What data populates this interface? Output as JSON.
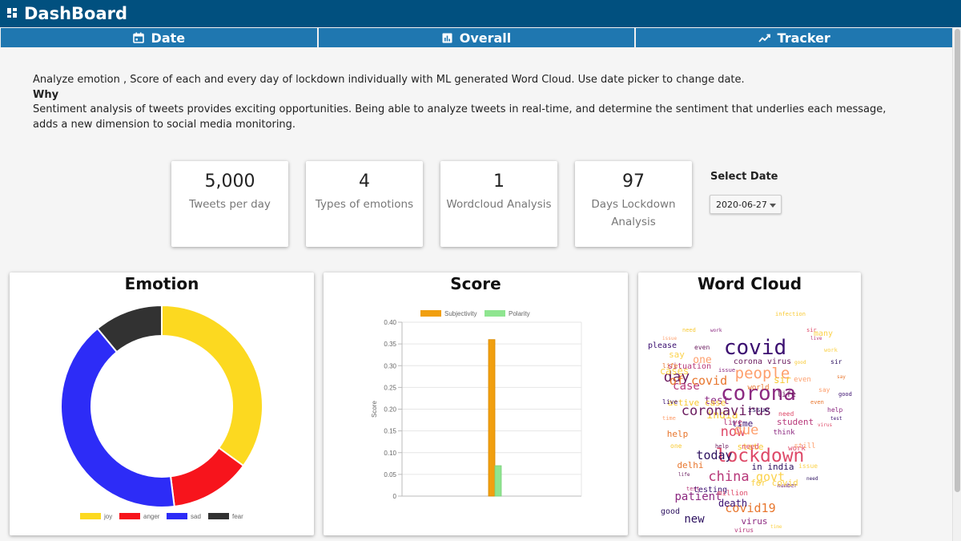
{
  "header": {
    "title": "DashBoard"
  },
  "tabs": [
    {
      "label": "Date",
      "icon": "calendar-icon"
    },
    {
      "label": "Overall",
      "icon": "bar-chart-icon"
    },
    {
      "label": "Tracker",
      "icon": "trend-line-icon"
    }
  ],
  "intro": {
    "line1": "Analyze emotion , Score of each and every day of lockdown individually with ML generated Word Cloud. Use date picker to change date.",
    "why": "Why",
    "line2": "Sentiment analysis of tweets provides exciting opportunities. Being able to analyze tweets in real-time, and determine the sentiment that underlies each message, adds a new dimension to social media monitoring."
  },
  "stats": [
    {
      "value": "5,000",
      "label": "Tweets per day"
    },
    {
      "value": "4",
      "label": "Types of emotions"
    },
    {
      "value": "1",
      "label": "Wordcloud Analysis"
    },
    {
      "value": "97",
      "label": "Days Lockdown Analysis"
    }
  ],
  "date_picker": {
    "label": "Select Date",
    "value": "2020-06-27"
  },
  "cards": {
    "emotion": {
      "title": "Emotion"
    },
    "score": {
      "title": "Score"
    },
    "wordcloud": {
      "title": "Word Cloud"
    }
  },
  "colors": {
    "header_bg": "#01507f",
    "tabs_bg": "#1f77b0",
    "joy": "#fcd920",
    "anger": "#f7141c",
    "sad": "#2d2cf7",
    "fear": "#323232",
    "subjectivity": "#f19f0f",
    "polarity": "#8fe590"
  },
  "chart_data": [
    {
      "type": "pie",
      "variant": "doughnut",
      "categories": [
        "joy",
        "anger",
        "sad",
        "fear"
      ],
      "values": [
        35,
        13,
        41,
        11
      ],
      "legend": "bottom"
    },
    {
      "type": "bar",
      "categories": [
        ""
      ],
      "series": [
        {
          "name": "Subjectivity",
          "values": [
            0.36
          ]
        },
        {
          "name": "Polarity",
          "values": [
            0.07
          ]
        }
      ],
      "ylabel": "Score",
      "ylim": [
        0,
        0.4
      ],
      "yticks": [
        "0",
        "0.05",
        "0.10",
        "0.15",
        "0.20",
        "0.25",
        "0.30",
        "0.35",
        "0.40"
      ],
      "grid": true,
      "legend": "top"
    }
  ],
  "wordcloud_words": [
    "covid",
    "corona",
    "lockdown",
    "people",
    "india",
    "day",
    "china",
    "govt",
    "new",
    "covid19",
    "death",
    "patient",
    "now",
    "due",
    "state",
    "coronavirus",
    "case",
    "cases",
    "today",
    "delhi",
    "time",
    "test",
    "work",
    "one",
    "sir",
    "life",
    "situation",
    "say",
    "good",
    "help",
    "testing",
    "virus",
    "million",
    "still",
    "active case",
    "corona virus",
    "student",
    "many",
    "issue",
    "world",
    "please",
    "think",
    "need",
    "even",
    "infection",
    "number",
    "live",
    "for covid",
    "in india",
    "of covid"
  ]
}
